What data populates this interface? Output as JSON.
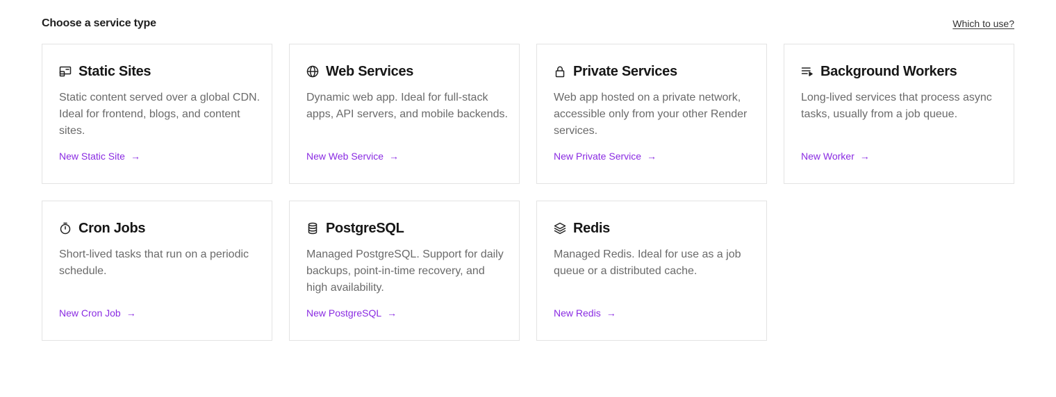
{
  "header": {
    "title": "Choose a service type",
    "help_link": "Which to use?"
  },
  "cards": [
    {
      "title": "Static Sites",
      "icon": "static-site-icon",
      "description": "Static content served over a global CDN. Ideal for frontend, blogs, and content sites.",
      "link": "New Static Site"
    },
    {
      "title": "Web Services",
      "icon": "globe-icon",
      "description": "Dynamic web app. Ideal for full-stack apps, API servers, and mobile backends.",
      "link": "New Web Service"
    },
    {
      "title": "Private Services",
      "icon": "lock-icon",
      "description": "Web app hosted on a private network, accessible only from your other Render services.",
      "link": "New Private Service"
    },
    {
      "title": "Background Workers",
      "icon": "queue-icon",
      "description": "Long-lived services that process async tasks, usually from a job queue.",
      "link": "New Worker"
    },
    {
      "title": "Cron Jobs",
      "icon": "stopwatch-icon",
      "description": "Short-lived tasks that run on a periodic schedule.",
      "link": "New Cron Job"
    },
    {
      "title": "PostgreSQL",
      "icon": "database-icon",
      "description": "Managed PostgreSQL. Support for daily backups, point-in-time recovery, and high availability.",
      "link": "New PostgreSQL"
    },
    {
      "title": "Redis",
      "icon": "layers-icon",
      "description": "Managed Redis. Ideal for use as a job queue or a distributed cache.",
      "link": "New Redis"
    }
  ],
  "colors": {
    "accent": "#8a2be2",
    "border": "#e3e3e3",
    "muted_text": "#6a6a6a"
  }
}
